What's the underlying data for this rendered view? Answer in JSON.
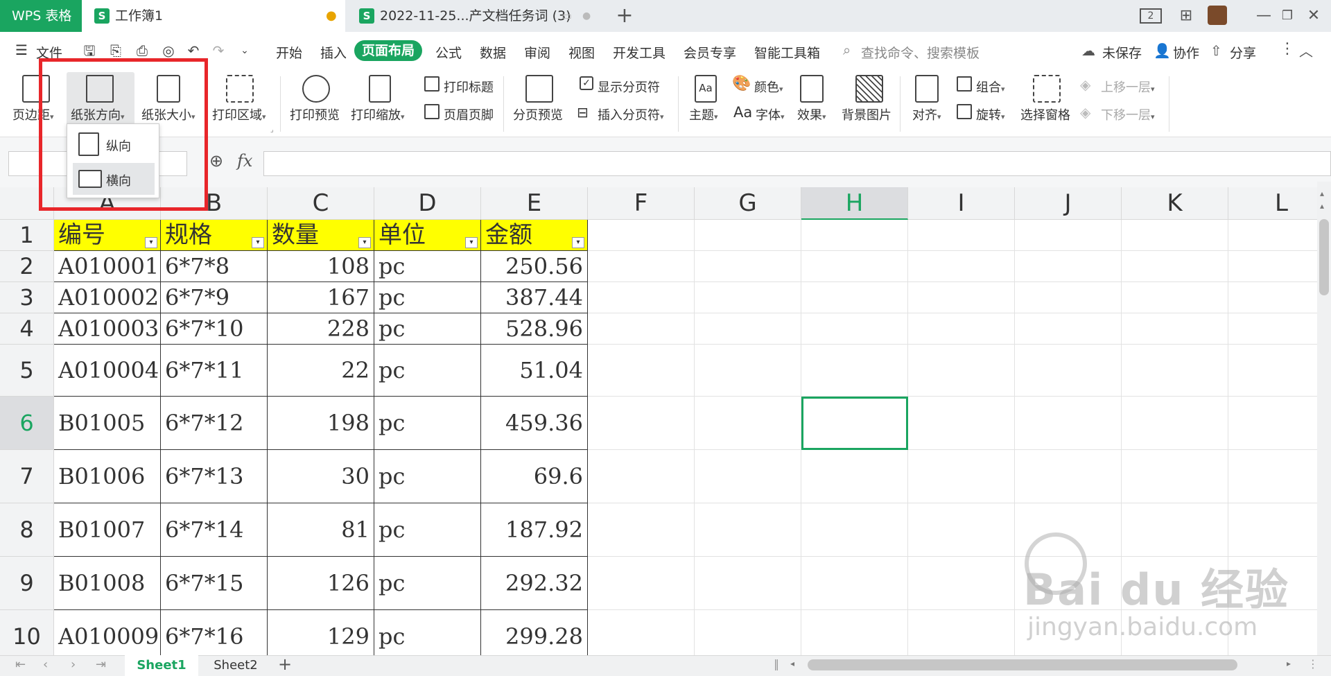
{
  "titlebar": {
    "app_tab": "WPS 表格",
    "doc_tabs": [
      {
        "icon": "S",
        "label": "工作簿1"
      },
      {
        "icon": "S",
        "label": "2022-11-25...产文档任务词 (3)"
      }
    ],
    "new_tab": "+",
    "page_num": "2"
  },
  "menu": {
    "file": "文件",
    "items": [
      "开始",
      "插入",
      "页面布局",
      "公式",
      "数据",
      "审阅",
      "视图",
      "开发工具",
      "会员专享",
      "智能工具箱"
    ],
    "active": "页面布局",
    "search_placeholder": "查找命令、搜索模板",
    "unsaved": "未保存",
    "collab": "协作",
    "share": "分享"
  },
  "ribbon": {
    "margin": "页边距",
    "orientation": "纸张方向",
    "size": "纸张大小",
    "print_area": "打印区域",
    "print_preview": "打印预览",
    "print_scale": "打印缩放",
    "print_title": "打印标题",
    "header_footer": "页眉页脚",
    "page_break_preview": "分页预览",
    "show_page_break": "显示分页符",
    "insert_page_break": "插入分页符",
    "theme": "主题",
    "color": "颜色",
    "font": "字体",
    "font_prefix": "Aa",
    "effect": "效果",
    "bg_image": "背景图片",
    "align": "对齐",
    "group": "组合",
    "rotate": "旋转",
    "select_pane": "选择窗格",
    "bring_forward": "上移一层",
    "send_backward": "下移一层"
  },
  "dropdown": {
    "portrait": "纵向",
    "landscape": "横向"
  },
  "formula": {
    "fx": "fx"
  },
  "grid": {
    "columns": [
      "A",
      "B",
      "C",
      "D",
      "E",
      "F",
      "G",
      "H",
      "I",
      "J",
      "K",
      "L"
    ],
    "active_col": "H",
    "active_row": "6",
    "headers": [
      "编号",
      "规格",
      "数量",
      "单位",
      "金额"
    ],
    "rows": [
      {
        "n": "2",
        "a": "A010001",
        "b": "6*7*8",
        "c": "108",
        "d": "pc",
        "e": "250.56"
      },
      {
        "n": "3",
        "a": "A010002",
        "b": "6*7*9",
        "c": "167",
        "d": "pc",
        "e": "387.44"
      },
      {
        "n": "4",
        "a": "A010003",
        "b": "6*7*10",
        "c": "228",
        "d": "pc",
        "e": "528.96"
      },
      {
        "n": "5",
        "a": "A010004",
        "b": "6*7*11",
        "c": "22",
        "d": "pc",
        "e": "51.04"
      },
      {
        "n": "6",
        "a": "B01005",
        "b": "6*7*12",
        "c": "198",
        "d": "pc",
        "e": "459.36"
      },
      {
        "n": "7",
        "a": "B01006",
        "b": "6*7*13",
        "c": "30",
        "d": "pc",
        "e": "69.6"
      },
      {
        "n": "8",
        "a": "B01007",
        "b": "6*7*14",
        "c": "81",
        "d": "pc",
        "e": "187.92"
      },
      {
        "n": "9",
        "a": "B01008",
        "b": "6*7*15",
        "c": "126",
        "d": "pc",
        "e": "292.32"
      },
      {
        "n": "10",
        "a": "A010009",
        "b": "6*7*16",
        "c": "129",
        "d": "pc",
        "e": "299.28"
      }
    ]
  },
  "sheets": {
    "tabs": [
      "Sheet1",
      "Sheet2"
    ],
    "active": "Sheet1",
    "add": "+"
  },
  "watermark": {
    "logo": "Bai du 经验",
    "url": "jingyan.baidu.com"
  },
  "colors": {
    "accent": "#1aa560",
    "header_fill": "#ffff00",
    "highlight": "#e8262a"
  }
}
